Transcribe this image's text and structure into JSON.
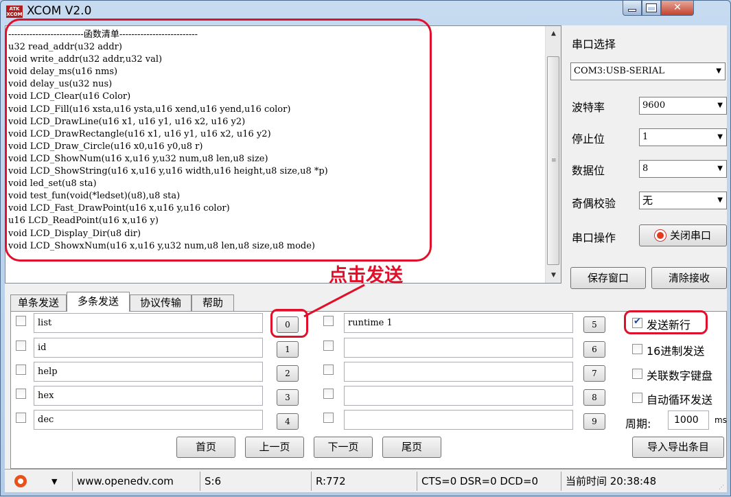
{
  "window": {
    "title": "XCOM V2.0",
    "logo_text": "ATK XCOM"
  },
  "receive": {
    "lines": [
      "-------------------------函数清单--------------------------",
      "u32 read_addr(u32 addr)",
      "void write_addr(u32 addr,u32 val)",
      "void delay_ms(u16 nms)",
      "void delay_us(u32 nus)",
      "void LCD_Clear(u16 Color)",
      "void LCD_Fill(u16 xsta,u16 ysta,u16 xend,u16 yend,u16 color)",
      "void LCD_DrawLine(u16 x1, u16 y1, u16 x2, u16 y2)",
      "void LCD_DrawRectangle(u16 x1, u16 y1, u16 x2, u16 y2)",
      "void LCD_Draw_Circle(u16 x0,u16 y0,u8 r)",
      "void LCD_ShowNum(u16 x,u16 y,u32 num,u8 len,u8 size)",
      "void LCD_ShowString(u16 x,u16 y,u16 width,u16 height,u8 size,u8 *p)",
      "void led_set(u8 sta)",
      "void test_fun(void(*ledset)(u8),u8 sta)",
      "void LCD_Fast_DrawPoint(u16 x,u16 y,u16 color)",
      "u16 LCD_ReadPoint(u16 x,u16 y)",
      "void LCD_Display_Dir(u8 dir)",
      "void LCD_ShowxNum(u16 x,u16 y,u32 num,u8 len,u8 size,u8 mode)"
    ]
  },
  "settings": {
    "port_label": "串口选择",
    "port_value": "COM3:USB-SERIAL",
    "baud_label": "波特率",
    "baud_value": "9600",
    "stopbits_label": "停止位",
    "stopbits_value": "1",
    "databits_label": "数据位",
    "databits_value": "8",
    "parity_label": "奇偶校验",
    "parity_value": "无",
    "operate_label": "串口操作",
    "close_port_button": "关闭串口",
    "save_window_button": "保存窗口",
    "clear_receive_button": "清除接收"
  },
  "annotation": "点击发送",
  "tabs": [
    "单条发送",
    "多条发送",
    "协议传输",
    "帮助"
  ],
  "multi_send": {
    "left_rows": [
      {
        "checked": false,
        "text": "list",
        "button": "0"
      },
      {
        "checked": false,
        "text": "id",
        "button": "1"
      },
      {
        "checked": false,
        "text": "help",
        "button": "2"
      },
      {
        "checked": false,
        "text": "hex",
        "button": "3"
      },
      {
        "checked": false,
        "text": "dec",
        "button": "4"
      }
    ],
    "right_rows": [
      {
        "checked": false,
        "text": "runtime 1",
        "button": "5"
      },
      {
        "checked": false,
        "text": "",
        "button": "6"
      },
      {
        "checked": false,
        "text": "",
        "button": "7"
      },
      {
        "checked": false,
        "text": "",
        "button": "8"
      },
      {
        "checked": false,
        "text": "",
        "button": "9"
      }
    ],
    "options": [
      {
        "label": "发送新行",
        "checked": true
      },
      {
        "label": "16进制发送",
        "checked": false
      },
      {
        "label": "关联数字键盘",
        "checked": false
      },
      {
        "label": "自动循环发送",
        "checked": false
      }
    ],
    "period_label": "周期:",
    "period_value": "1000",
    "period_unit": "ms",
    "first_page": "首页",
    "prev_page": "上一页",
    "next_page": "下一页",
    "last_page": "尾页",
    "import_export": "导入导出条目"
  },
  "status": {
    "website": "www.openedv.com",
    "sent": "S:6",
    "received": "R:772",
    "signals": "CTS=0 DSR=0 DCD=0",
    "time": "当前时间 20:38:48"
  }
}
